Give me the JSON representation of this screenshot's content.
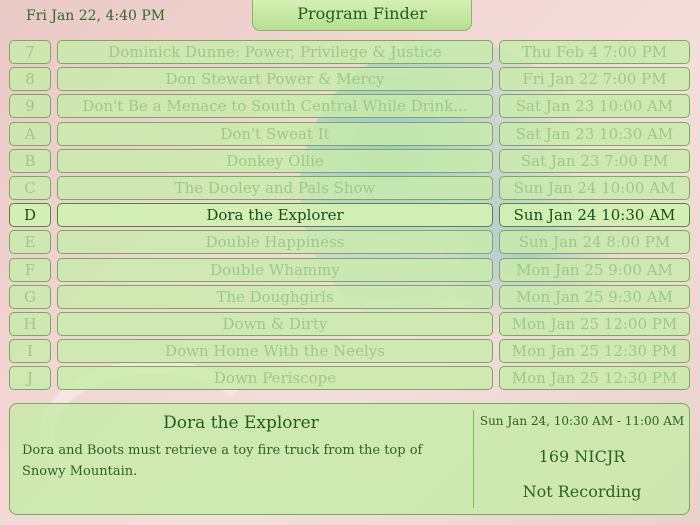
{
  "clock": "Fri Jan 22, 4:40 PM",
  "title": "Program Finder",
  "rows": [
    {
      "key": "7",
      "title": "Dominick Dunne: Power, Privilege & Justice",
      "time": "Thu Feb 4 7:00 PM"
    },
    {
      "key": "8",
      "title": "Don Stewart Power & Mercy",
      "time": "Fri Jan 22 7:00 PM"
    },
    {
      "key": "9",
      "title": "Don't Be a Menace to South Central While Drink...",
      "time": "Sat Jan 23 10:00 AM"
    },
    {
      "key": "A",
      "title": "Don't Sweat It",
      "time": "Sat Jan 23 10:30 AM"
    },
    {
      "key": "B",
      "title": "Donkey Ollie",
      "time": "Sat Jan 23 7:00 PM"
    },
    {
      "key": "C",
      "title": "The Dooley and Pals Show",
      "time": "Sun Jan 24 10:00 AM"
    },
    {
      "key": "D",
      "title": "Dora the Explorer",
      "time": "Sun Jan 24 10:30 AM",
      "selected": true
    },
    {
      "key": "E",
      "title": "Double Happiness",
      "time": "Sun Jan 24 8:00 PM"
    },
    {
      "key": "F",
      "title": "Double Whammy",
      "time": "Mon Jan 25 9:00 AM"
    },
    {
      "key": "G",
      "title": "The Doughgirls",
      "time": "Mon Jan 25 9:30 AM"
    },
    {
      "key": "H",
      "title": "Down & Dirty",
      "time": "Mon Jan 25 12:00 PM"
    },
    {
      "key": "I",
      "title": "Down Home With the Neelys",
      "time": "Mon Jan 25 12:30 PM"
    },
    {
      "key": "J",
      "title": "Down Periscope",
      "time": "Mon Jan 25 12:30 PM"
    }
  ],
  "details": {
    "title": "Dora the Explorer",
    "description": "Dora and Boots must retrieve a toy fire truck from the top of Snowy Mountain.",
    "time_range": "Sun Jan 24, 10:30 AM - 11:00 AM",
    "channel": "169 NICJR",
    "recording_status": "Not Recording"
  }
}
